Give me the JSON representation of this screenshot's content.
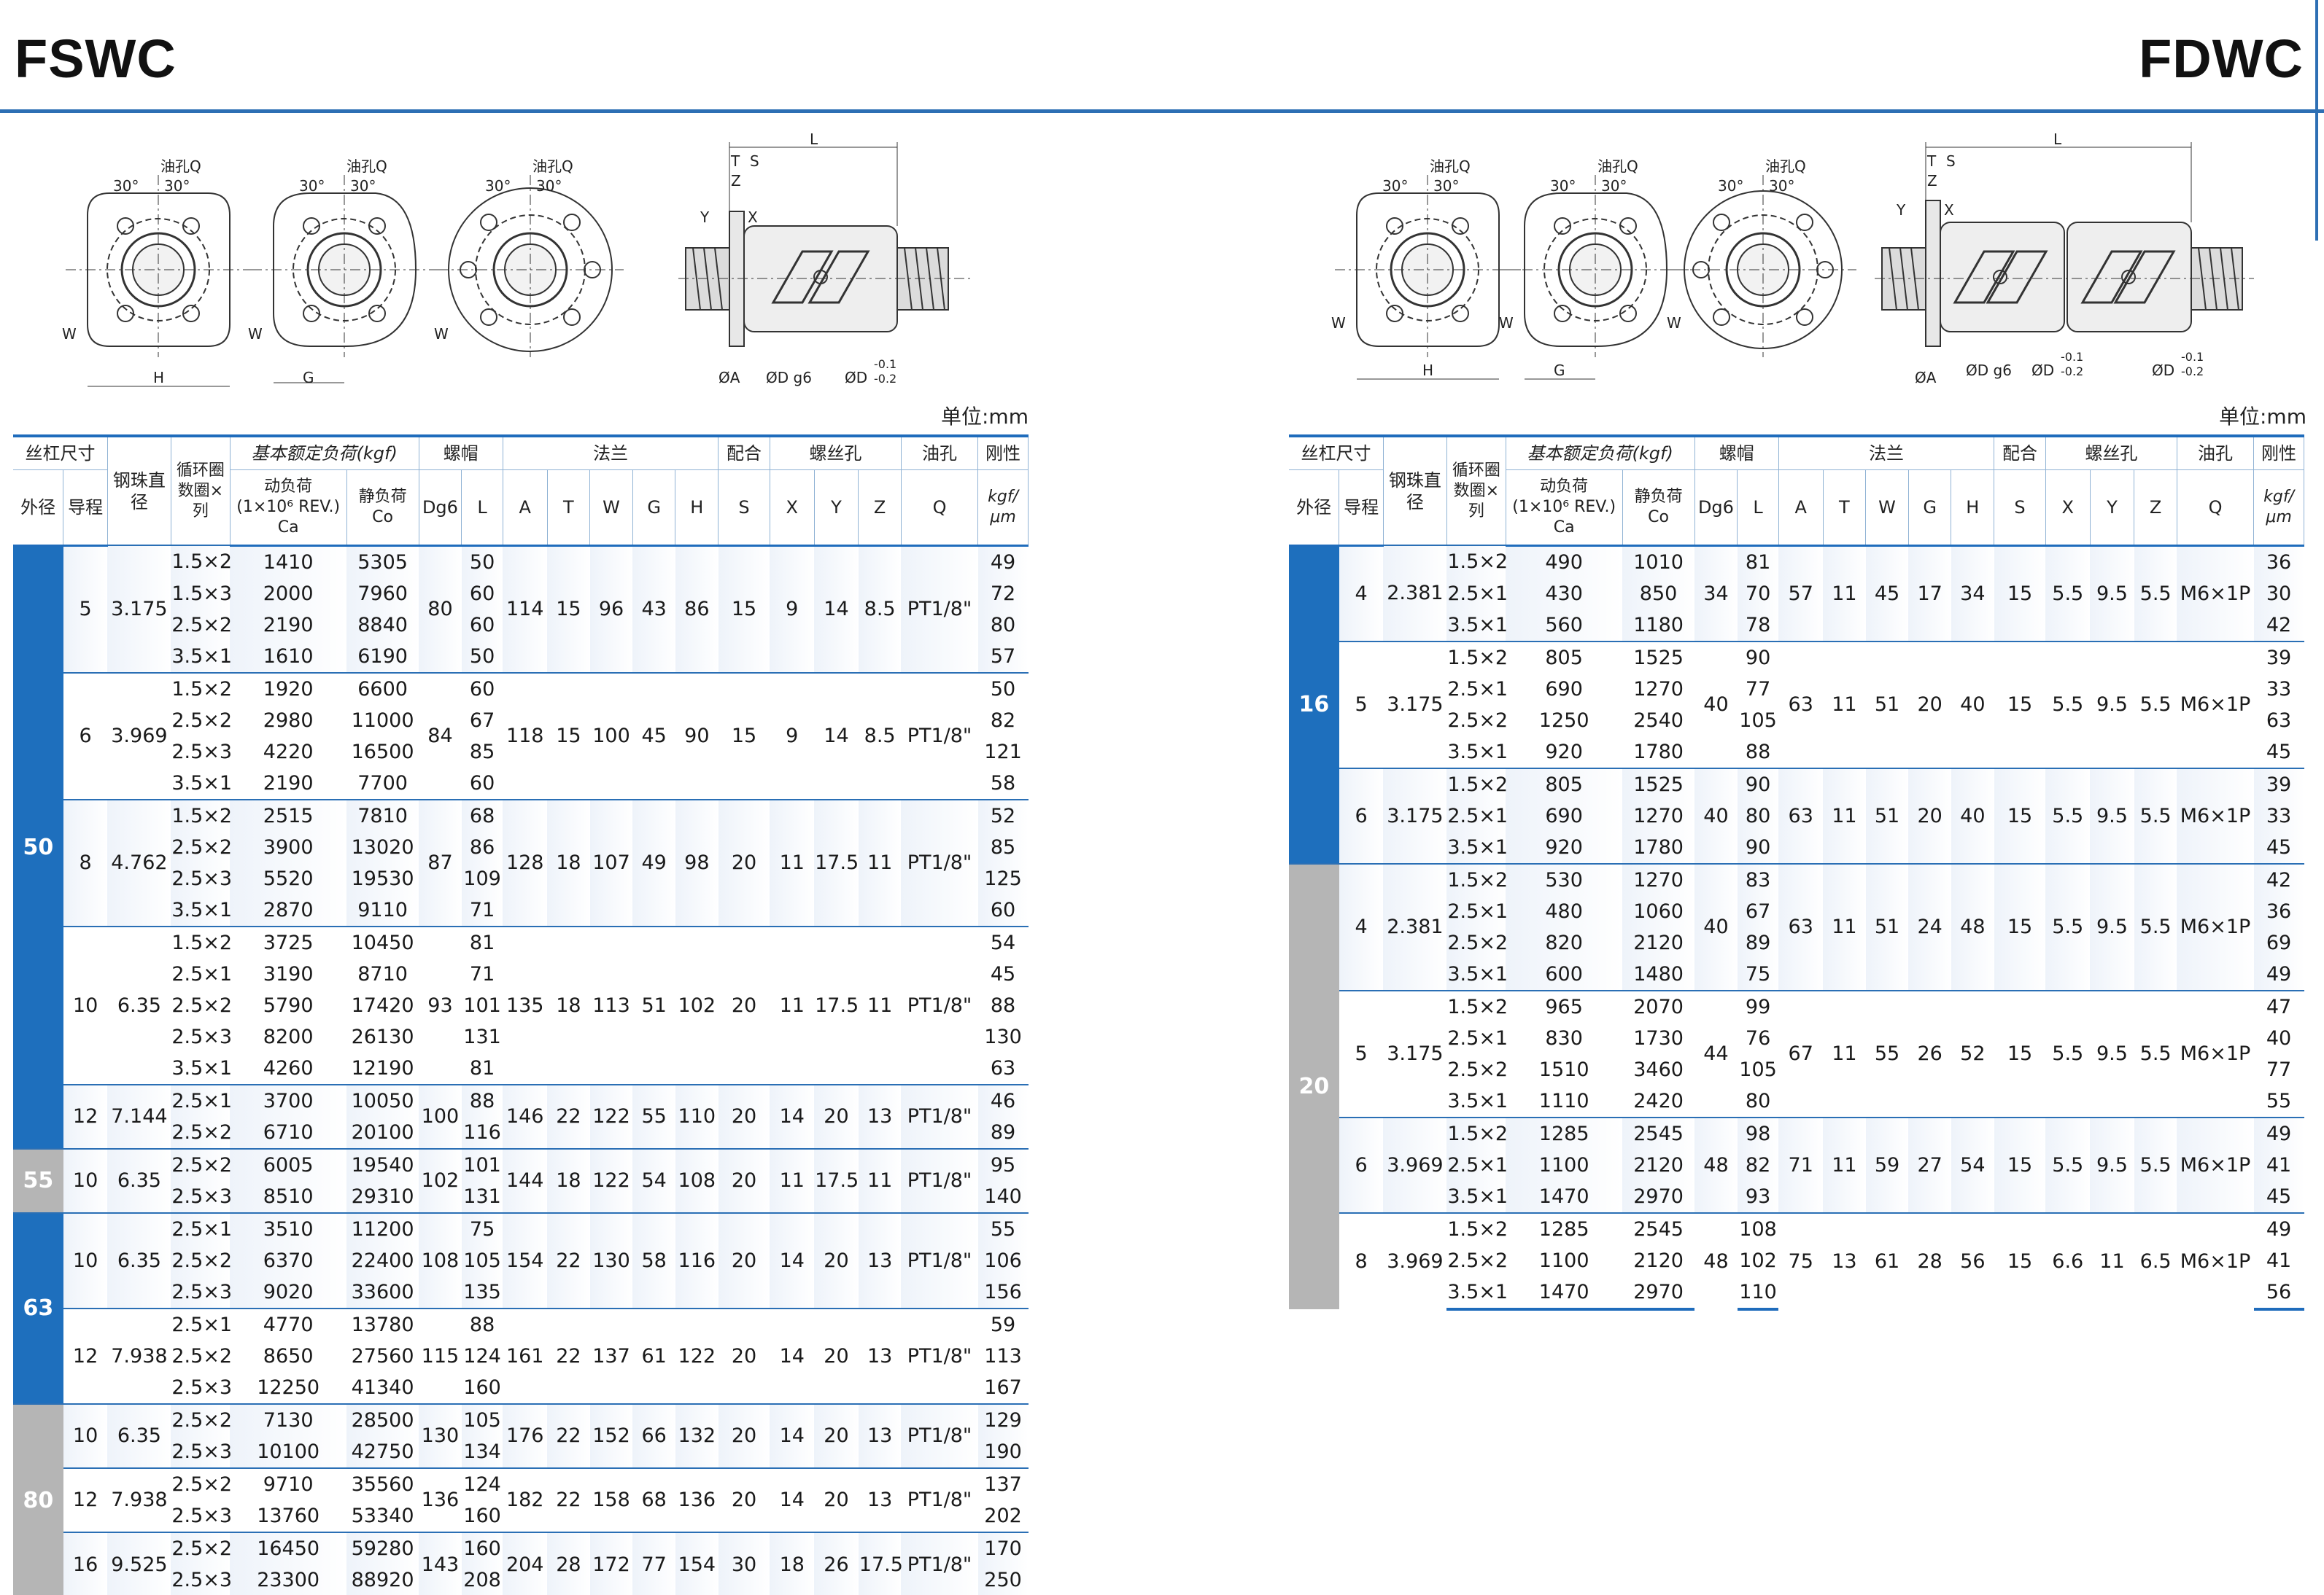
{
  "header": {
    "left_title": "FSWC",
    "right_title": "FDWC"
  },
  "drawing_labels": {
    "oil_hole": "油孔Q",
    "angle": "30°",
    "W": "W",
    "H": "H",
    "G": "G",
    "L": "L",
    "T": "T",
    "S": "S",
    "Z": "Z",
    "Y": "Y",
    "X": "X",
    "dia_A": "ØA",
    "dia_D_g6": "ØD g6",
    "dia_D_tol": "ØD",
    "tol_upper": "-0.1",
    "tol_lower": "-0.2"
  },
  "unit_label": "单位:mm",
  "headers": {
    "screw_size": "丝杠尺寸",
    "ball_dia": "钢珠直径",
    "circuits": "循环圈数圈×列",
    "basic_load": "基本额定负荷(kgf)",
    "nut": "螺帽",
    "flange": "法兰",
    "fit": "配合",
    "bolt_hole": "螺丝孔",
    "oil_hole": "油孔",
    "stiffness": "刚性",
    "outer_dia": "外径",
    "lead": "导程",
    "dyn_load_1": "动负荷",
    "dyn_load_2": "(1×10⁶ REV.)",
    "dyn_load_3": "Ca",
    "static_load_1": "静负荷",
    "static_load_2": "Co",
    "Dg6": "Dg6",
    "L": "L",
    "A": "A",
    "T": "T",
    "W": "W",
    "G": "G",
    "H": "H",
    "S": "S",
    "X": "X",
    "Y": "Y",
    "Z": "Z",
    "Q": "Q",
    "K_unit": "kgf/μm"
  },
  "fswc": [
    {
      "od": "50",
      "od_color": "blue",
      "groups": [
        {
          "lead": "5",
          "ball": "3.175",
          "Dg6": "80",
          "A": "114",
          "T": "15",
          "W": "96",
          "G": "43",
          "H": "86",
          "S": "15",
          "X": "9",
          "Y": "14",
          "Z": "8.5",
          "Q": "PT1/8\"",
          "rows": [
            {
              "c": "1.5×2",
              "ca": "1410",
              "co": "5305",
              "L": "50",
              "k": "49"
            },
            {
              "c": "1.5×3",
              "ca": "2000",
              "co": "7960",
              "L": "60",
              "k": "72"
            },
            {
              "c": "2.5×2",
              "ca": "2190",
              "co": "8840",
              "L": "60",
              "k": "80"
            },
            {
              "c": "3.5×1",
              "ca": "1610",
              "co": "6190",
              "L": "50",
              "k": "57"
            }
          ]
        },
        {
          "lead": "6",
          "ball": "3.969",
          "Dg6": "84",
          "A": "118",
          "T": "15",
          "W": "100",
          "G": "45",
          "H": "90",
          "S": "15",
          "X": "9",
          "Y": "14",
          "Z": "8.5",
          "Q": "PT1/8\"",
          "rows": [
            {
              "c": "1.5×2",
              "ca": "1920",
              "co": "6600",
              "L": "60",
              "k": "50"
            },
            {
              "c": "2.5×2",
              "ca": "2980",
              "co": "11000",
              "L": "67",
              "k": "82"
            },
            {
              "c": "2.5×3",
              "ca": "4220",
              "co": "16500",
              "L": "85",
              "k": "121"
            },
            {
              "c": "3.5×1",
              "ca": "2190",
              "co": "7700",
              "L": "60",
              "k": "58"
            }
          ]
        },
        {
          "lead": "8",
          "ball": "4.762",
          "Dg6": "87",
          "A": "128",
          "T": "18",
          "W": "107",
          "G": "49",
          "H": "98",
          "S": "20",
          "X": "11",
          "Y": "17.5",
          "Z": "11",
          "Q": "PT1/8\"",
          "rows": [
            {
              "c": "1.5×2",
              "ca": "2515",
              "co": "7810",
              "L": "68",
              "k": "52"
            },
            {
              "c": "2.5×2",
              "ca": "3900",
              "co": "13020",
              "L": "86",
              "k": "85"
            },
            {
              "c": "2.5×3",
              "ca": "5520",
              "co": "19530",
              "L": "109",
              "k": "125"
            },
            {
              "c": "3.5×1",
              "ca": "2870",
              "co": "9110",
              "L": "71",
              "k": "60"
            }
          ]
        },
        {
          "lead": "10",
          "ball": "6.35",
          "Dg6": "93",
          "A": "135",
          "T": "18",
          "W": "113",
          "G": "51",
          "H": "102",
          "S": "20",
          "X": "11",
          "Y": "17.5",
          "Z": "11",
          "Q": "PT1/8\"",
          "rows": [
            {
              "c": "1.5×2",
              "ca": "3725",
              "co": "10450",
              "L": "81",
              "k": "54"
            },
            {
              "c": "2.5×1",
              "ca": "3190",
              "co": "8710",
              "L": "71",
              "k": "45"
            },
            {
              "c": "2.5×2",
              "ca": "5790",
              "co": "17420",
              "L": "101",
              "k": "88"
            },
            {
              "c": "2.5×3",
              "ca": "8200",
              "co": "26130",
              "L": "131",
              "k": "130"
            },
            {
              "c": "3.5×1",
              "ca": "4260",
              "co": "12190",
              "L": "81",
              "k": "63"
            }
          ]
        },
        {
          "lead": "12",
          "ball": "7.144",
          "Dg6": "100",
          "A": "146",
          "T": "22",
          "W": "122",
          "G": "55",
          "H": "110",
          "S": "20",
          "X": "14",
          "Y": "20",
          "Z": "13",
          "Q": "PT1/8\"",
          "rows": [
            {
              "c": "2.5×1",
              "ca": "3700",
              "co": "10050",
              "L": "88",
              "k": "46"
            },
            {
              "c": "2.5×2",
              "ca": "6710",
              "co": "20100",
              "L": "116",
              "k": "89"
            }
          ]
        }
      ]
    },
    {
      "od": "55",
      "od_color": "gray",
      "groups": [
        {
          "lead": "10",
          "ball": "6.35",
          "Dg6": "102",
          "A": "144",
          "T": "18",
          "W": "122",
          "G": "54",
          "H": "108",
          "S": "20",
          "X": "11",
          "Y": "17.5",
          "Z": "11",
          "Q": "PT1/8\"",
          "rows": [
            {
              "c": "2.5×2",
              "ca": "6005",
              "co": "19540",
              "L": "101",
              "k": "95"
            },
            {
              "c": "2.5×3",
              "ca": "8510",
              "co": "29310",
              "L": "131",
              "k": "140"
            }
          ]
        }
      ]
    },
    {
      "od": "63",
      "od_color": "blue",
      "groups": [
        {
          "lead": "10",
          "ball": "6.35",
          "Dg6": "108",
          "A": "154",
          "T": "22",
          "W": "130",
          "G": "58",
          "H": "116",
          "S": "20",
          "X": "14",
          "Y": "20",
          "Z": "13",
          "Q": "PT1/8\"",
          "rows": [
            {
              "c": "2.5×1",
              "ca": "3510",
              "co": "11200",
              "L": "75",
              "k": "55"
            },
            {
              "c": "2.5×2",
              "ca": "6370",
              "co": "22400",
              "L": "105",
              "k": "106"
            },
            {
              "c": "2.5×3",
              "ca": "9020",
              "co": "33600",
              "L": "135",
              "k": "156"
            }
          ]
        },
        {
          "lead": "12",
          "ball": "7.938",
          "Dg6": "115",
          "A": "161",
          "T": "22",
          "W": "137",
          "G": "61",
          "H": "122",
          "S": "20",
          "X": "14",
          "Y": "20",
          "Z": "13",
          "Q": "PT1/8\"",
          "rows": [
            {
              "c": "2.5×1",
              "ca": "4770",
              "co": "13780",
              "L": "88",
              "k": "59"
            },
            {
              "c": "2.5×2",
              "ca": "8650",
              "co": "27560",
              "L": "124",
              "k": "113"
            },
            {
              "c": "2.5×3",
              "ca": "12250",
              "co": "41340",
              "L": "160",
              "k": "167"
            }
          ]
        }
      ]
    },
    {
      "od": "80",
      "od_color": "gray",
      "groups": [
        {
          "lead": "10",
          "ball": "6.35",
          "Dg6": "130",
          "A": "176",
          "T": "22",
          "W": "152",
          "G": "66",
          "H": "132",
          "S": "20",
          "X": "14",
          "Y": "20",
          "Z": "13",
          "Q": "PT1/8\"",
          "rows": [
            {
              "c": "2.5×2",
              "ca": "7130",
              "co": "28500",
              "L": "105",
              "k": "129"
            },
            {
              "c": "2.5×3",
              "ca": "10100",
              "co": "42750",
              "L": "134",
              "k": "190"
            }
          ]
        },
        {
          "lead": "12",
          "ball": "7.938",
          "Dg6": "136",
          "A": "182",
          "T": "22",
          "W": "158",
          "G": "68",
          "H": "136",
          "S": "20",
          "X": "14",
          "Y": "20",
          "Z": "13",
          "Q": "PT1/8\"",
          "rows": [
            {
              "c": "2.5×2",
              "ca": "9710",
              "co": "35560",
              "L": "124",
              "k": "137"
            },
            {
              "c": "2.5×3",
              "ca": "13760",
              "co": "53340",
              "L": "160",
              "k": "202"
            }
          ]
        },
        {
          "lead": "16",
          "ball": "9.525",
          "Dg6": "143",
          "A": "204",
          "T": "28",
          "W": "172",
          "G": "77",
          "H": "154",
          "S": "30",
          "X": "18",
          "Y": "26",
          "Z": "17.5",
          "Q": "PT1/8\"",
          "rows": [
            {
              "c": "2.5×2",
              "ca": "16450",
              "co": "59280",
              "L": "160",
              "k": "170"
            },
            {
              "c": "2.5×3",
              "ca": "23300",
              "co": "88920",
              "L": "208",
              "k": "250"
            }
          ]
        }
      ]
    }
  ],
  "fdwc": [
    {
      "od": "16",
      "od_color": "blue",
      "groups": [
        {
          "lead": "4",
          "ball": "2.381",
          "Dg6": "34",
          "A": "57",
          "T": "11",
          "W": "45",
          "G": "17",
          "H": "34",
          "S": "15",
          "X": "5.5",
          "Y": "9.5",
          "Z": "5.5",
          "Q": "M6×1P",
          "rows": [
            {
              "c": "1.5×2",
              "ca": "490",
              "co": "1010",
              "L": "81",
              "k": "36"
            },
            {
              "c": "2.5×1",
              "ca": "430",
              "co": "850",
              "L": "70",
              "k": "30"
            },
            {
              "c": "3.5×1",
              "ca": "560",
              "co": "1180",
              "L": "78",
              "k": "42"
            }
          ]
        },
        {
          "lead": "5",
          "ball": "3.175",
          "Dg6": "40",
          "A": "63",
          "T": "11",
          "W": "51",
          "G": "20",
          "H": "40",
          "S": "15",
          "X": "5.5",
          "Y": "9.5",
          "Z": "5.5",
          "Q": "M6×1P",
          "rows": [
            {
              "c": "1.5×2",
              "ca": "805",
              "co": "1525",
              "L": "90",
              "k": "39"
            },
            {
              "c": "2.5×1",
              "ca": "690",
              "co": "1270",
              "L": "77",
              "k": "33"
            },
            {
              "c": "2.5×2",
              "ca": "1250",
              "co": "2540",
              "L": "105",
              "k": "63"
            },
            {
              "c": "3.5×1",
              "ca": "920",
              "co": "1780",
              "L": "88",
              "k": "45"
            }
          ]
        },
        {
          "lead": "6",
          "ball": "3.175",
          "Dg6": "40",
          "A": "63",
          "T": "11",
          "W": "51",
          "G": "20",
          "H": "40",
          "S": "15",
          "X": "5.5",
          "Y": "9.5",
          "Z": "5.5",
          "Q": "M6×1P",
          "rows": [
            {
              "c": "1.5×2",
              "ca": "805",
              "co": "1525",
              "L": "90",
              "k": "39"
            },
            {
              "c": "2.5×1",
              "ca": "690",
              "co": "1270",
              "L": "80",
              "k": "33"
            },
            {
              "c": "3.5×1",
              "ca": "920",
              "co": "1780",
              "L": "90",
              "k": "45"
            }
          ]
        }
      ]
    },
    {
      "od": "20",
      "od_color": "gray",
      "groups": [
        {
          "lead": "4",
          "ball": "2.381",
          "Dg6": "40",
          "A": "63",
          "T": "11",
          "W": "51",
          "G": "24",
          "H": "48",
          "S": "15",
          "X": "5.5",
          "Y": "9.5",
          "Z": "5.5",
          "Q": "M6×1P",
          "rows": [
            {
              "c": "1.5×2",
              "ca": "530",
              "co": "1270",
              "L": "83",
              "k": "42"
            },
            {
              "c": "2.5×1",
              "ca": "480",
              "co": "1060",
              "L": "67",
              "k": "36"
            },
            {
              "c": "2.5×2",
              "ca": "820",
              "co": "2120",
              "L": "89",
              "k": "69"
            },
            {
              "c": "3.5×1",
              "ca": "600",
              "co": "1480",
              "L": "75",
              "k": "49"
            }
          ]
        },
        {
          "lead": "5",
          "ball": "3.175",
          "Dg6": "44",
          "A": "67",
          "T": "11",
          "W": "55",
          "G": "26",
          "H": "52",
          "S": "15",
          "X": "5.5",
          "Y": "9.5",
          "Z": "5.5",
          "Q": "M6×1P",
          "rows": [
            {
              "c": "1.5×2",
              "ca": "965",
              "co": "2070",
              "L": "99",
              "k": "47"
            },
            {
              "c": "2.5×1",
              "ca": "830",
              "co": "1730",
              "L": "76",
              "k": "40"
            },
            {
              "c": "2.5×2",
              "ca": "1510",
              "co": "3460",
              "L": "105",
              "k": "77"
            },
            {
              "c": "3.5×1",
              "ca": "1110",
              "co": "2420",
              "L": "80",
              "k": "55"
            }
          ]
        },
        {
          "lead": "6",
          "ball": "3.969",
          "Dg6": "48",
          "A": "71",
          "T": "11",
          "W": "59",
          "G": "27",
          "H": "54",
          "S": "15",
          "X": "5.5",
          "Y": "9.5",
          "Z": "5.5",
          "Q": "M6×1P",
          "rows": [
            {
              "c": "1.5×2",
              "ca": "1285",
              "co": "2545",
              "L": "98",
              "k": "49"
            },
            {
              "c": "2.5×1",
              "ca": "1100",
              "co": "2120",
              "L": "82",
              "k": "41"
            },
            {
              "c": "3.5×1",
              "ca": "1470",
              "co": "2970",
              "L": "93",
              "k": "45"
            }
          ]
        },
        {
          "lead": "8",
          "ball": "3.969",
          "Dg6": "48",
          "A": "75",
          "T": "13",
          "W": "61",
          "G": "28",
          "H": "56",
          "S": "15",
          "X": "6.6",
          "Y": "11",
          "Z": "6.5",
          "Q": "M6×1P",
          "rows": [
            {
              "c": "1.5×2",
              "ca": "1285",
              "co": "2545",
              "L": "108",
              "k": "49"
            },
            {
              "c": "2.5×2",
              "ca": "1100",
              "co": "2120",
              "L": "102",
              "k": "41"
            },
            {
              "c": "3.5×1",
              "ca": "1470",
              "co": "2970",
              "L": "110",
              "k": "56"
            }
          ]
        }
      ]
    }
  ],
  "colors": {
    "blue": "#1e6fbd",
    "gray": "#b5b5b5",
    "rule": "#1f6cbc"
  }
}
